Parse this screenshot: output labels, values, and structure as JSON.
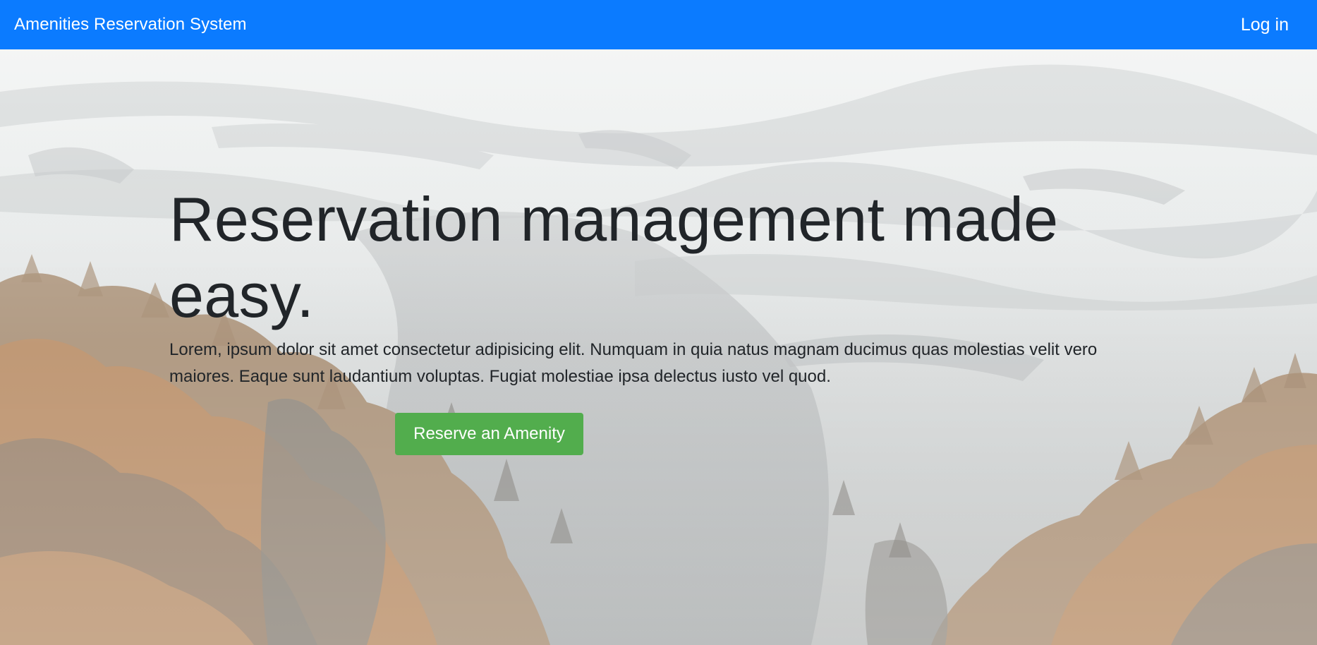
{
  "navbar": {
    "brand": "Amenities Reservation System",
    "login_label": "Log in",
    "background": "#0b7bff"
  },
  "hero": {
    "headline": "Reservation management made easy.",
    "description": "Lorem, ipsum dolor sit amet consectetur adipisicing elit. Numquam in quia natus magnam ducimus quas molestias velit vero maiores. Eaque sunt laudantium voluptas. Fugiat molestiae ipsa delectus iusto vel quod.",
    "cta_label": "Reserve an Amenity",
    "cta_color": "#52ad4d",
    "background_image": "snowy-mountain-autumn-forest-photo"
  }
}
